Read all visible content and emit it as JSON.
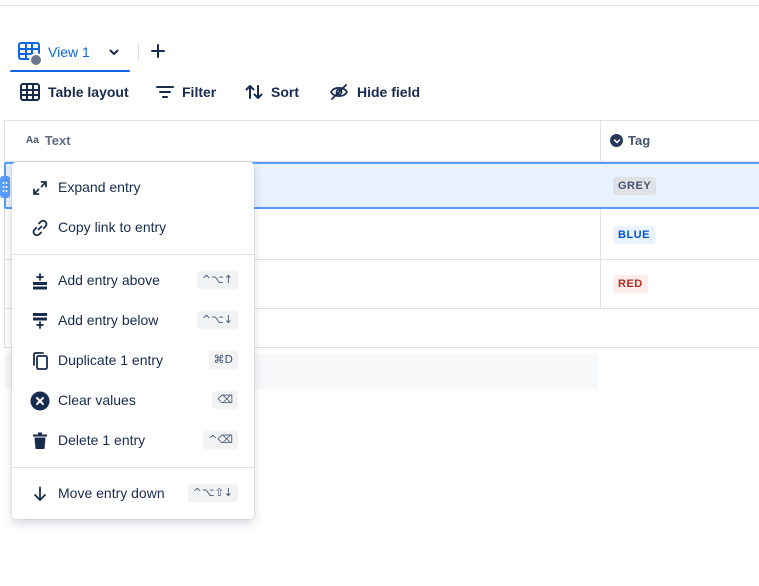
{
  "views": {
    "active_tab": "View 1",
    "add_view": "+"
  },
  "toolbar": {
    "table_layout": "Table layout",
    "filter": "Filter",
    "sort": "Sort",
    "hide_field": "Hide field"
  },
  "table": {
    "columns": [
      {
        "icon": "Aa",
        "label": "Text"
      },
      {
        "icon": "dropdown-icon",
        "label": "Tag"
      }
    ],
    "rows": [
      {
        "tag": "GREY",
        "tag_color": "#dfe1e6"
      },
      {
        "tag": "BLUE",
        "tag_color": "#e9f2ff"
      },
      {
        "tag": "RED",
        "tag_color": "#ffeceb"
      }
    ]
  },
  "context_menu": {
    "items": [
      {
        "label": "Expand entry",
        "icon": "expand-icon",
        "shortcut": ""
      },
      {
        "label": "Copy link to entry",
        "icon": "link-icon",
        "shortcut": ""
      },
      {
        "label": "Add entry above",
        "icon": "add-above-icon",
        "shortcut": "^⌥↑"
      },
      {
        "label": "Add entry below",
        "icon": "add-below-icon",
        "shortcut": "^⌥↓"
      },
      {
        "label": "Duplicate 1 entry",
        "icon": "duplicate-icon",
        "shortcut": "⌘D"
      },
      {
        "label": "Clear values",
        "icon": "clear-icon",
        "shortcut": "⌫"
      },
      {
        "label": "Delete 1 entry",
        "icon": "trash-icon",
        "shortcut": "^⌫"
      },
      {
        "label": "Move entry down",
        "icon": "arrow-down-icon",
        "shortcut": "^⌥⇧↓"
      }
    ]
  },
  "colors": {
    "accent": "#0c66e4",
    "selection": "#579dff",
    "text": "#172b4d"
  }
}
